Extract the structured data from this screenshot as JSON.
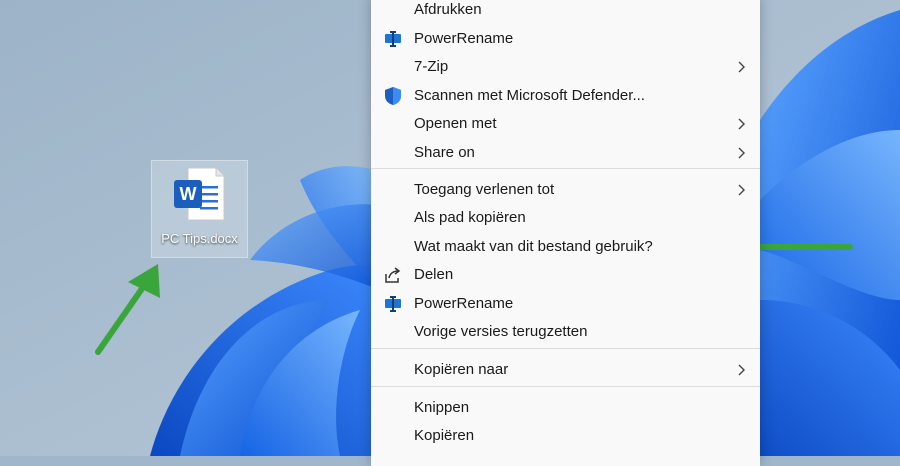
{
  "desktop": {
    "file_label": "PC Tips.docx",
    "word_letter": "W"
  },
  "menu": {
    "items": [
      {
        "label": "Afdrukken",
        "icon": "",
        "submenu": false
      },
      {
        "label": "PowerRename",
        "icon": "powerrename-icon",
        "submenu": false
      },
      {
        "label": "7-Zip",
        "icon": "",
        "submenu": true
      },
      {
        "label": "Scannen met Microsoft Defender...",
        "icon": "defender-shield-icon",
        "submenu": false
      },
      {
        "label": "Openen met",
        "icon": "",
        "submenu": true
      },
      {
        "label": "Share on",
        "icon": "",
        "submenu": true
      },
      {
        "label": "Toegang verlenen tot",
        "icon": "",
        "submenu": true
      },
      {
        "label": "Als pad kopiëren",
        "icon": "",
        "submenu": false
      },
      {
        "label": "Wat maakt van dit bestand gebruik?",
        "icon": "",
        "submenu": false
      },
      {
        "label": "Delen",
        "icon": "share-icon",
        "submenu": false
      },
      {
        "label": "PowerRename",
        "icon": "powerrename-icon",
        "submenu": false
      },
      {
        "label": "Vorige versies terugzetten",
        "icon": "",
        "submenu": false
      },
      {
        "label": "Kopiëren naar",
        "icon": "",
        "submenu": true
      },
      {
        "label": "Knippen",
        "icon": "",
        "submenu": false
      },
      {
        "label": "Kopiëren",
        "icon": "",
        "submenu": false
      }
    ]
  },
  "colors": {
    "accent_arrow": "#3aa53a",
    "wallpaper_blue": "#1f6fe0",
    "menu_background": "#f9f9f9"
  }
}
